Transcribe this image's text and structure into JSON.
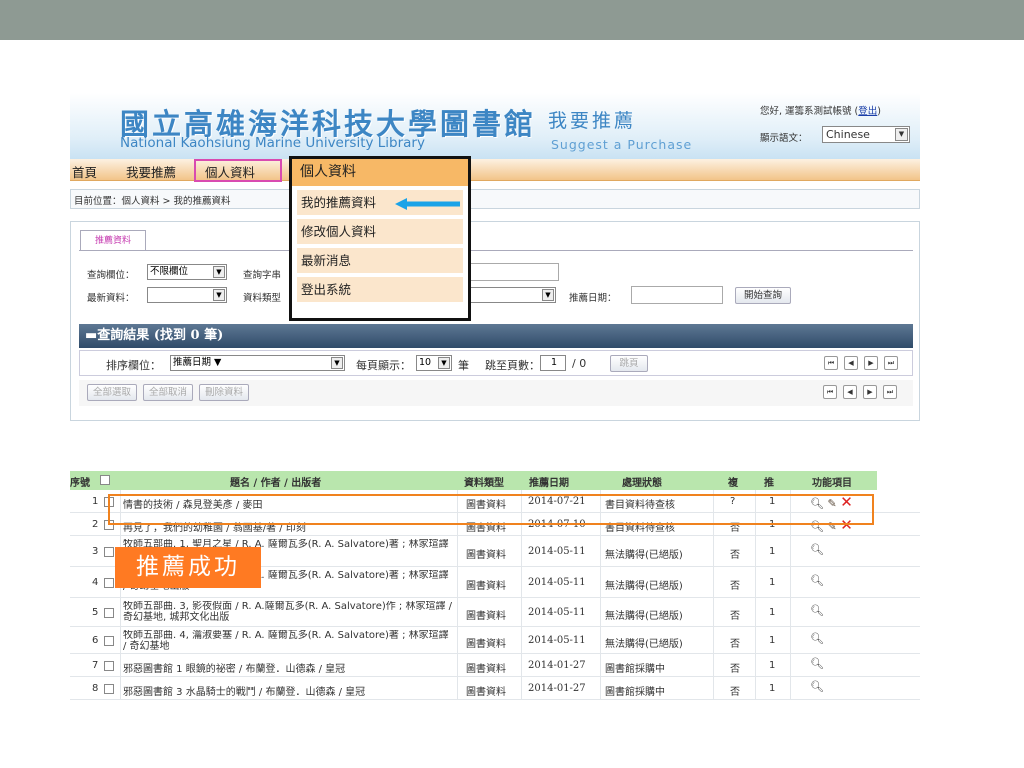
{
  "header": {
    "title_zh": "國立高雄海洋科技大學圖書館",
    "title_en": "National Kaohsiung Marine University Library",
    "subtitle_zh": "我要推薦",
    "subtitle_en": "Suggest a Purchase",
    "greeting": "您好, 運籌系測試帳號 (",
    "logout": "登出",
    "greeting_end": ")",
    "lang_label": "顯示語文：",
    "lang_value": "Chinese"
  },
  "nav": {
    "home": "首頁",
    "recommend": "我要推薦",
    "personal": "個人資料"
  },
  "breadcrumb": "目前位置：個人資料 > 我的推薦資料",
  "query": {
    "tab": "推薦資料",
    "field_label": "查詢欄位：",
    "field_value": "不限欄位",
    "string_label": "查詢字串",
    "latest_label": "最新資料：",
    "type_label": "資料類型",
    "date_label": "推薦日期：",
    "search_btn": "開始查詢"
  },
  "results": {
    "title": "查詢結果 (找到 0 筆)",
    "sort_label": "排序欄位：",
    "sort_value": "推薦日期 ▼",
    "per_page_label": "每頁顯示：",
    "per_page_value": "10",
    "per_page_unit": "筆",
    "jump_label": "跳至頁數：",
    "jump_value": "1",
    "jump_total": "/ 0",
    "jump_btn": "跳頁",
    "select_all": "全部選取",
    "deselect_all": "全部取消",
    "delete": "刪除資料"
  },
  "table": {
    "headers": [
      "序號",
      "題名 / 作者 / 出版者",
      "資料類型",
      "推薦日期",
      "處理狀態",
      "複",
      "推",
      "功能項目"
    ],
    "rows": [
      {
        "no": "1",
        "title": "情書的技術 / 森見登美彥 / 麥田",
        "type": "圖書資料",
        "date": "2014-07-21",
        "status": "書目資料待查核",
        "dup": "?",
        "rec": "1",
        "edit": true
      },
      {
        "no": "2",
        "title": "再見了，我們的幼稚園 / 翁國基/著 / 印刻",
        "type": "圖書資料",
        "date": "2014-07-10",
        "status": "書目資料待查核",
        "dup": "否",
        "rec": "1",
        "edit": true
      },
      {
        "no": "3",
        "title": "牧師五部曲. 1, 聖月之星 / R. A. 薩爾瓦多(R. A. Salvatore)著 ; 林家瑄譯 / 奇幻基地出版",
        "type": "圖書資料",
        "date": "2014-05-11",
        "status": "無法購得(已絕版)",
        "dup": "否",
        "rec": "1",
        "edit": false
      },
      {
        "no": "4",
        "title": "牧師五部曲. 2, 降林暗影 / R. A. 薩爾瓦多(R. A. Salvatore)著 ; 林家瑄譯 / 奇幻基地出版",
        "type": "圖書資料",
        "date": "2014-05-11",
        "status": "無法購得(已絕版)",
        "dup": "否",
        "rec": "1",
        "edit": false
      },
      {
        "no": "5",
        "title": "牧師五部曲. 3, 影夜假面 / R. A.薩爾瓦多(R. A. Salvatore)作 ; 林家瑄譯 / 奇幻基地, 城邦文化出版",
        "type": "圖書資料",
        "date": "2014-05-11",
        "status": "無法購得(已絕版)",
        "dup": "否",
        "rec": "1",
        "edit": false
      },
      {
        "no": "6",
        "title": "牧師五部曲. 4, 瀹淑要塞 / R. A. 薩爾瓦多(R. A. Salvatore)著 ; 林家瑄譯 / 奇幻基地",
        "type": "圖書資料",
        "date": "2014-05-11",
        "status": "無法購得(已絕版)",
        "dup": "否",
        "rec": "1",
        "edit": false
      },
      {
        "no": "7",
        "title": "邪惡圖書館 1 眼鏡的祕密 / 布蘭登．山德森 / 皇冠",
        "type": "圖書資料",
        "date": "2014-01-27",
        "status": "圖書館採購中",
        "dup": "否",
        "rec": "1",
        "edit": false
      },
      {
        "no": "8",
        "title": "邪惡圖書館 3 水晶騎士的戰鬥 / 布蘭登．山德森 / 皇冠",
        "type": "圖書資料",
        "date": "2014-01-27",
        "status": "圖書館採購中",
        "dup": "否",
        "rec": "1",
        "edit": false
      }
    ]
  },
  "overlay": {
    "menu_head": "個人資料",
    "menu_items": [
      "我的推薦資料",
      "修改個人資料",
      "最新消息",
      "登出系統"
    ],
    "success": "推薦成功"
  },
  "icons": {
    "search": "magnifier-icon",
    "edit": "pencil-icon",
    "delete": "x-icon",
    "arrow": "left-arrow-icon"
  },
  "colors": {
    "top_bar": "#8e9a93",
    "logo": "#3d86c4",
    "nav_bg": "#f2c489",
    "results_header": "#2f4b69",
    "table_header": "#b9e6ad",
    "menu_head": "#f7b866",
    "highlight_nav": "#d94bb0",
    "highlight_row": "#f0821e",
    "success": "#ff7a22",
    "arrow": "#1aa3e8"
  }
}
